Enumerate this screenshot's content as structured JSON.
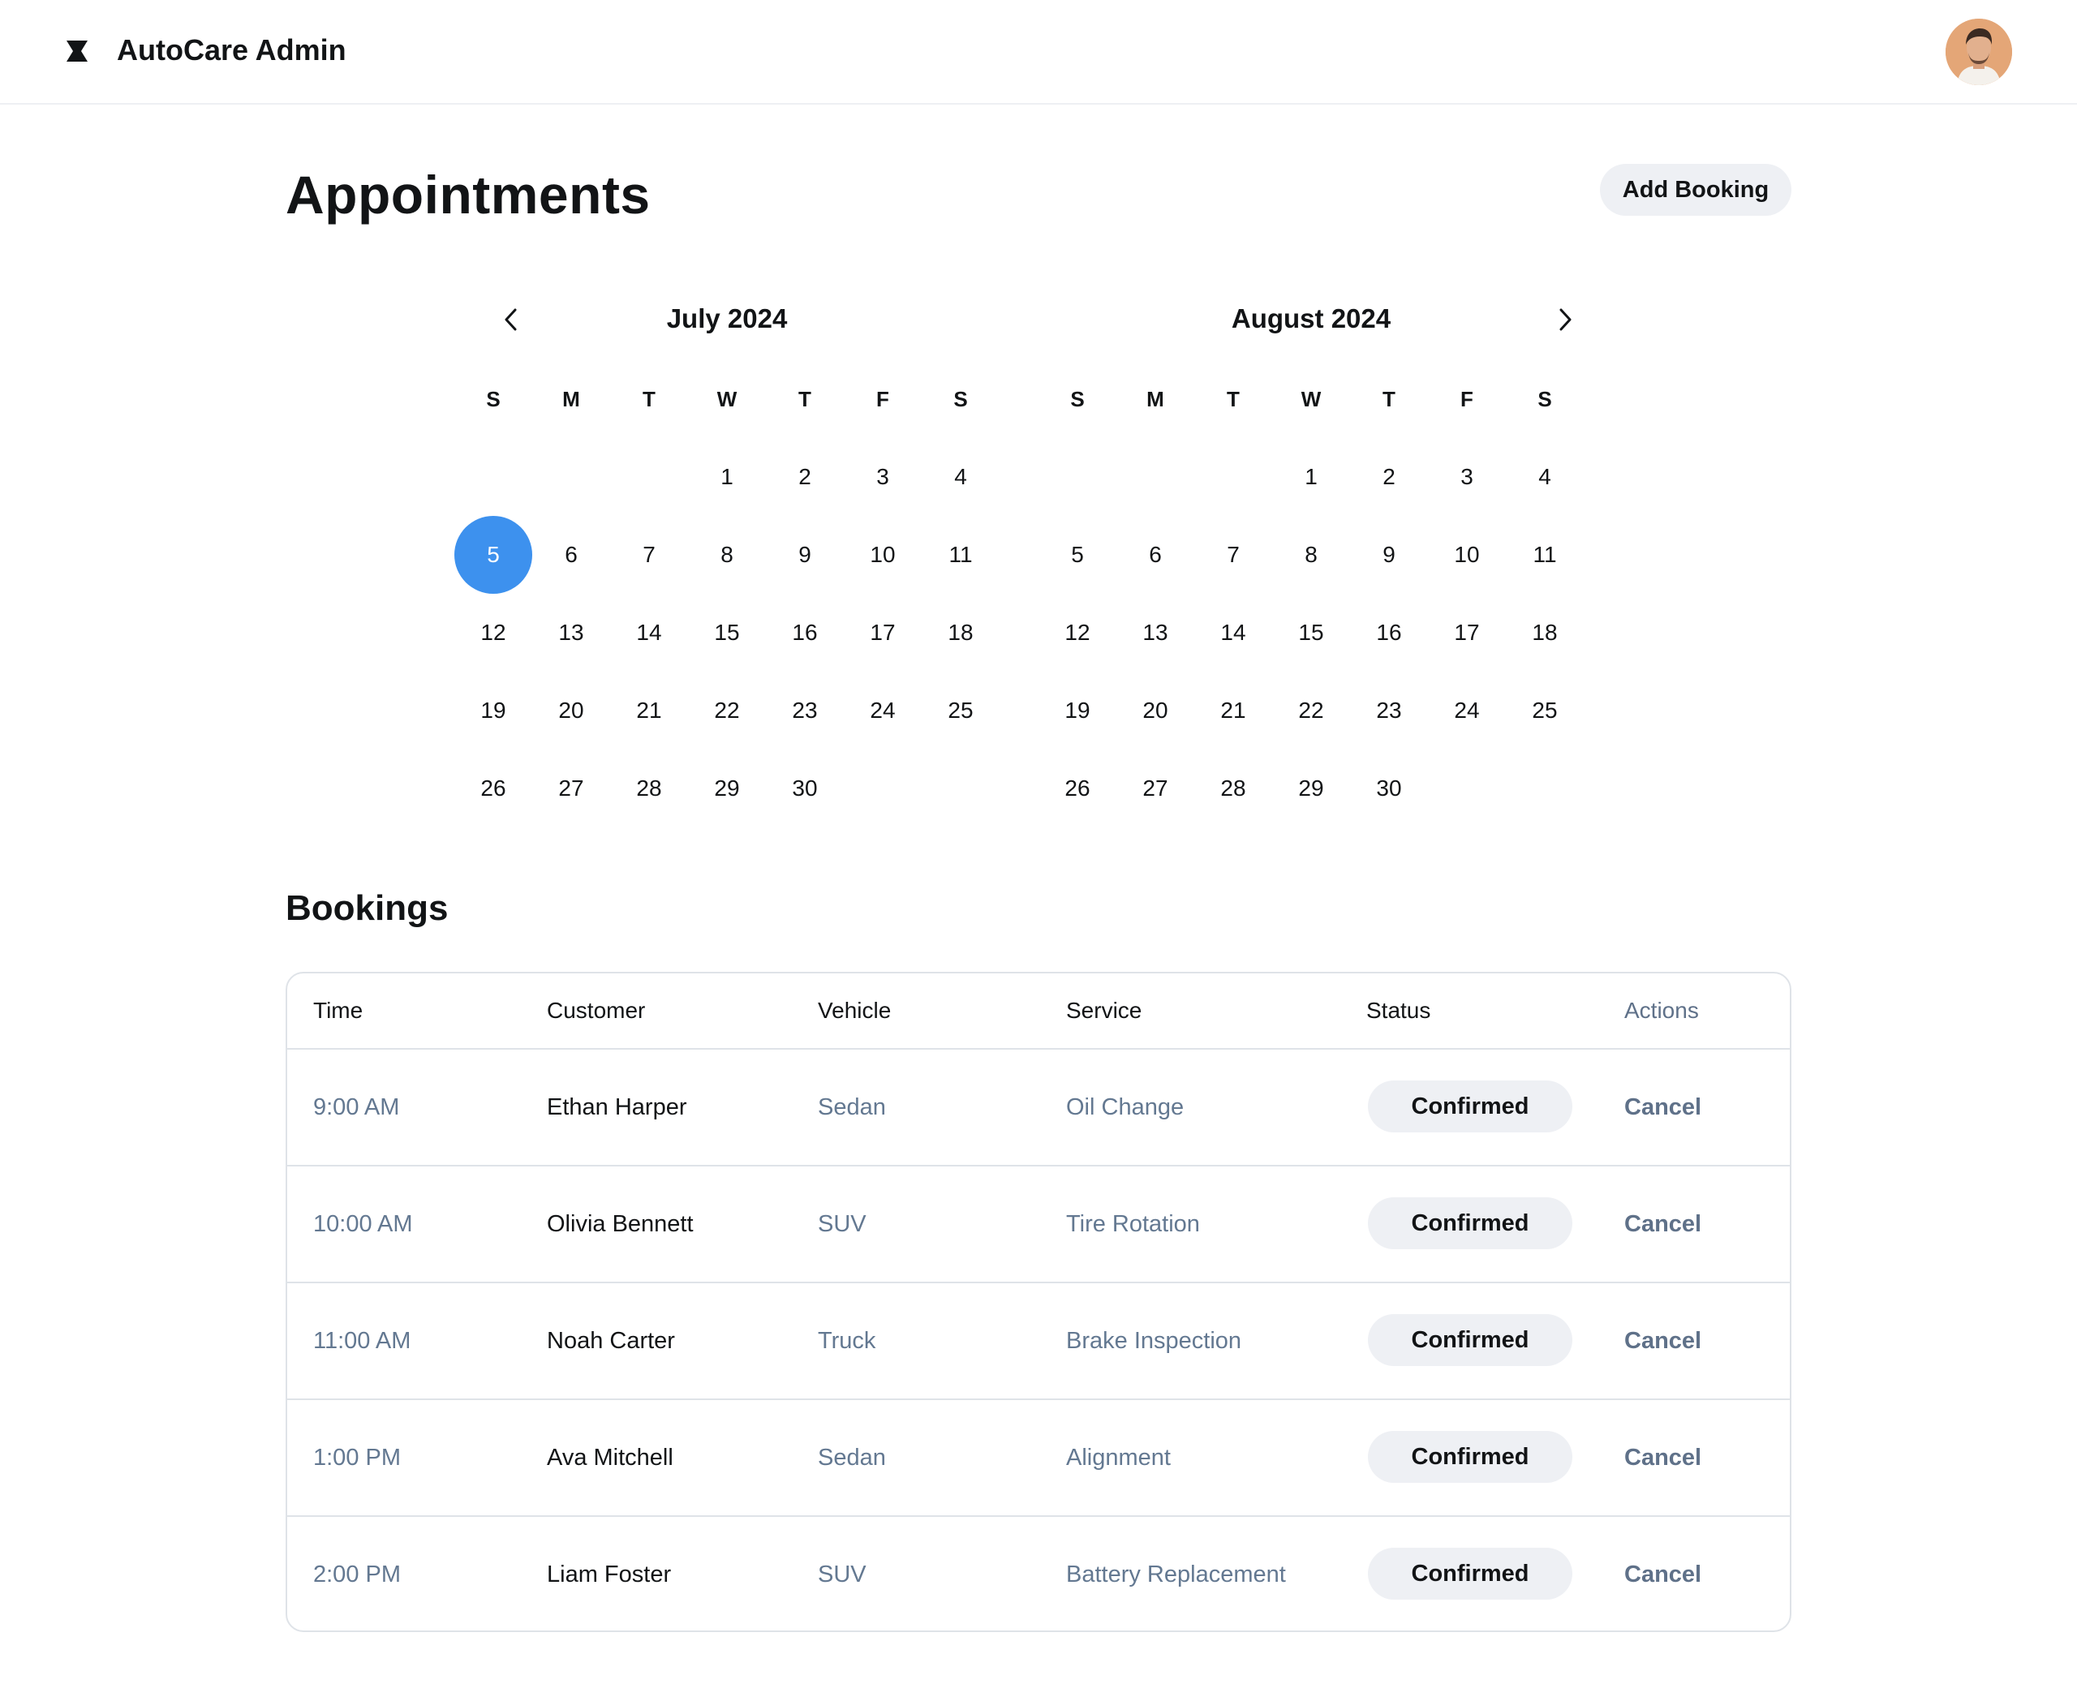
{
  "header": {
    "app_title": "AutoCare Admin",
    "logo_icon": "hourglass-logo-icon",
    "avatar_icon": "user-avatar"
  },
  "page": {
    "title": "Appointments",
    "add_button": "Add Booking"
  },
  "calendar": {
    "prev_icon": "chevron-left-icon",
    "next_icon": "chevron-right-icon",
    "selected_color": "#3d91ee",
    "weekday_labels": [
      "S",
      "M",
      "T",
      "W",
      "T",
      "F",
      "S"
    ],
    "months": [
      {
        "title": "July 2024",
        "weeks": [
          [
            "",
            "",
            "",
            "1",
            "2",
            "3",
            "4"
          ],
          [
            "5",
            "6",
            "7",
            "8",
            "9",
            "10",
            "11"
          ],
          [
            "12",
            "13",
            "14",
            "15",
            "16",
            "17",
            "18"
          ],
          [
            "19",
            "20",
            "21",
            "22",
            "23",
            "24",
            "25"
          ],
          [
            "26",
            "27",
            "28",
            "29",
            "30",
            "",
            ""
          ]
        ],
        "selected_day": "5"
      },
      {
        "title": "August 2024",
        "weeks": [
          [
            "",
            "",
            "",
            "1",
            "2",
            "3",
            "4"
          ],
          [
            "5",
            "6",
            "7",
            "8",
            "9",
            "10",
            "11"
          ],
          [
            "12",
            "13",
            "14",
            "15",
            "16",
            "17",
            "18"
          ],
          [
            "19",
            "20",
            "21",
            "22",
            "23",
            "24",
            "25"
          ],
          [
            "26",
            "27",
            "28",
            "29",
            "30",
            "",
            ""
          ]
        ],
        "selected_day": ""
      }
    ]
  },
  "bookings": {
    "title": "Bookings",
    "columns": [
      "Time",
      "Customer",
      "Vehicle",
      "Service",
      "Status",
      "Actions"
    ],
    "rows": [
      {
        "time": "9:00 AM",
        "customer": "Ethan Harper",
        "vehicle": "Sedan",
        "service": "Oil Change",
        "status": "Confirmed",
        "action": "Cancel"
      },
      {
        "time": "10:00 AM",
        "customer": "Olivia Bennett",
        "vehicle": "SUV",
        "service": "Tire Rotation",
        "status": "Confirmed",
        "action": "Cancel"
      },
      {
        "time": "11:00 AM",
        "customer": "Noah Carter",
        "vehicle": "Truck",
        "service": "Brake Inspection",
        "status": "Confirmed",
        "action": "Cancel"
      },
      {
        "time": "1:00 PM",
        "customer": "Ava Mitchell",
        "vehicle": "Sedan",
        "service": "Alignment",
        "status": "Confirmed",
        "action": "Cancel"
      },
      {
        "time": "2:00 PM",
        "customer": "Liam Foster",
        "vehicle": "SUV",
        "service": "Battery Replacement",
        "status": "Confirmed",
        "action": "Cancel"
      }
    ]
  }
}
